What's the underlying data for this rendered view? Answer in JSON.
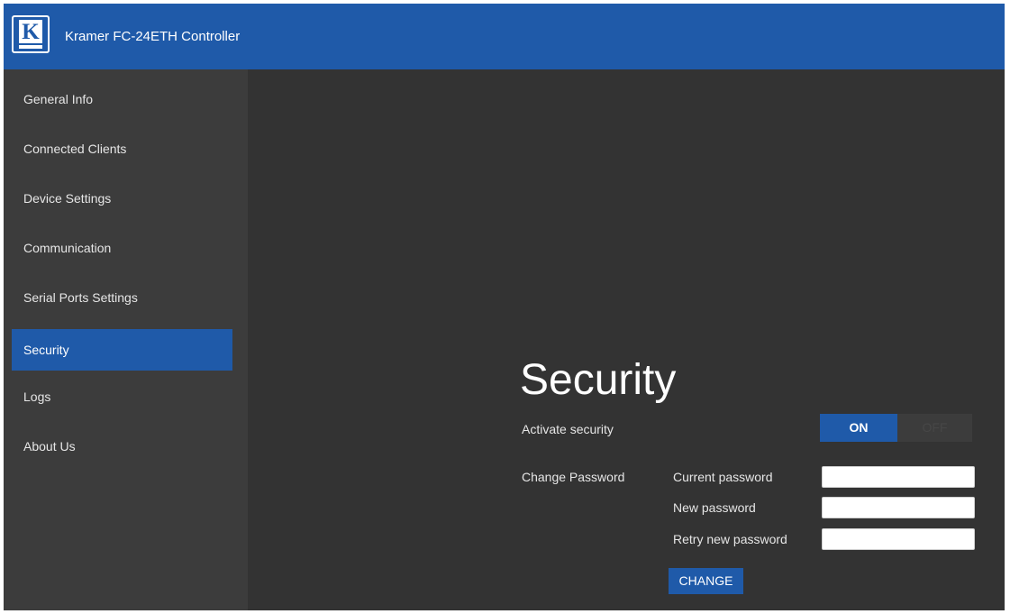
{
  "header": {
    "logo_letter": "K",
    "title": "Kramer FC-24ETH Controller"
  },
  "sidebar": {
    "items": [
      {
        "label": "General Info",
        "active": false
      },
      {
        "label": "Connected Clients",
        "active": false
      },
      {
        "label": "Device Settings",
        "active": false
      },
      {
        "label": "Communication",
        "active": false
      },
      {
        "label": "Serial Ports Settings",
        "active": false
      },
      {
        "label": "Security",
        "active": true
      },
      {
        "label": "Logs",
        "active": false
      },
      {
        "label": "About Us",
        "active": false
      }
    ]
  },
  "security": {
    "title": "Security",
    "activate_label": "Activate security",
    "toggle": {
      "on_label": "ON",
      "off_label": "OFF",
      "value": "ON"
    },
    "change_password_label": "Change Password",
    "fields": {
      "current": {
        "label": "Current password",
        "value": ""
      },
      "new": {
        "label": "New password",
        "value": ""
      },
      "retry": {
        "label": "Retry new password",
        "value": ""
      }
    },
    "change_button": "CHANGE"
  },
  "colors": {
    "brand_blue": "#1f5aa9",
    "background": "#333333",
    "sidebar": "#3c3c3c"
  }
}
